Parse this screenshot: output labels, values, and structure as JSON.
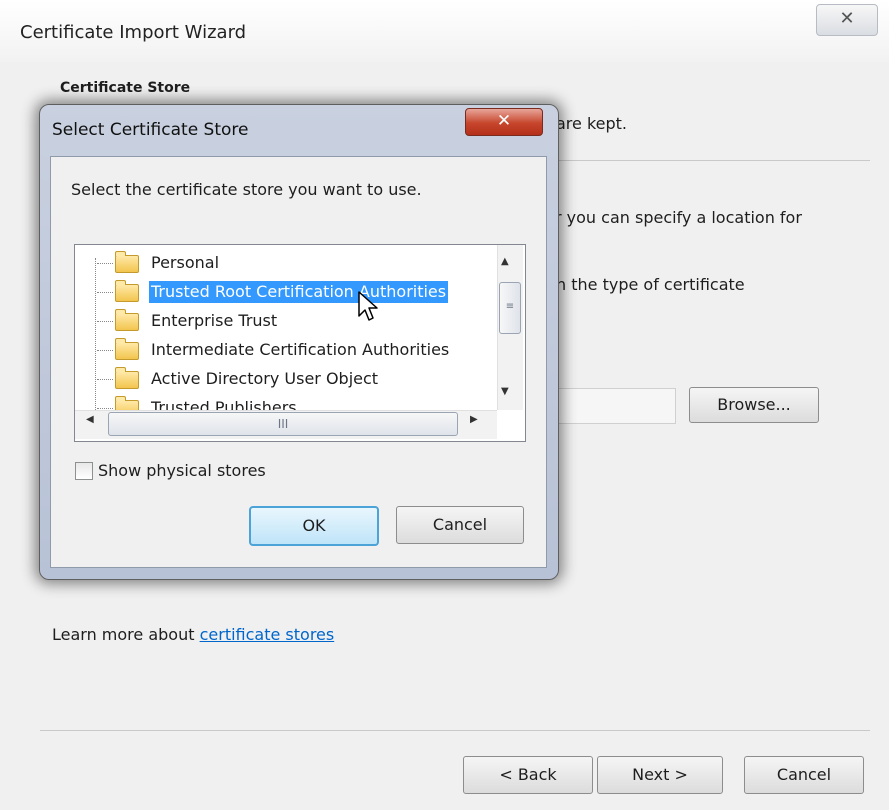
{
  "wizard": {
    "title": "Certificate Import Wizard",
    "close_glyph": "✕",
    "section_title": "Certificate Store",
    "partial_text_1": "are kept.",
    "partial_text_2": "r you can specify a location for",
    "partial_text_3": "n the type of certificate",
    "browse_label": "Browse...",
    "learn_more_prefix": "Learn more about ",
    "learn_more_link": "certificate stores",
    "back_label": "< Back",
    "next_label": "Next >",
    "cancel_label": "Cancel"
  },
  "dialog": {
    "title": "Select Certificate Store",
    "close_glyph": "✕",
    "prompt": "Select the certificate store you want to use.",
    "stores": [
      {
        "label": "Personal",
        "selected": false
      },
      {
        "label": "Trusted Root Certification Authorities",
        "selected": true
      },
      {
        "label": "Enterprise Trust",
        "selected": false
      },
      {
        "label": "Intermediate Certification Authorities",
        "selected": false
      },
      {
        "label": "Active Directory User Object",
        "selected": false
      },
      {
        "label": "Trusted Publishers",
        "selected": false
      }
    ],
    "hscroll_grip": "III",
    "vscroll_grip": "≡",
    "show_physical_label": "Show physical stores",
    "show_physical_checked": false,
    "ok_label": "OK",
    "cancel_label": "Cancel"
  },
  "colors": {
    "selection": "#3399ff",
    "link": "#0066cc",
    "close_red": "#c6452b"
  },
  "icons": [
    "close-icon",
    "folder-icon",
    "cursor-icon",
    "scroll-up-arrow-icon",
    "scroll-down-arrow-icon",
    "scroll-left-arrow-icon",
    "scroll-right-arrow-icon"
  ]
}
